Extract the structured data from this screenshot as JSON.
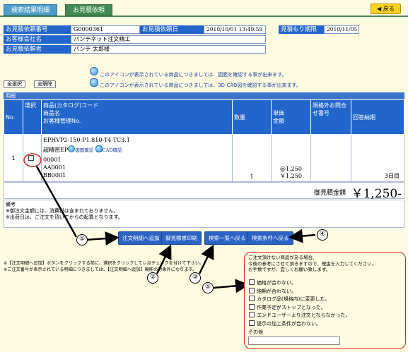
{
  "tabs": {
    "search_results": "検索結果明細",
    "quote_request": "お見積依頼"
  },
  "back_button": "◀ 戻る",
  "header_fields": {
    "quote_request_no_label": "お見積依頼番号",
    "quote_request_no": "G0000361",
    "request_date_label": "お見積依頼日",
    "request_date": "2010/10/01 13:49:59",
    "deadline_label": "見積もり期限",
    "deadline": "2010/11/05",
    "company_label": "お客様会社名",
    "company": "パンチネット注文精工",
    "requester_label": "お見積依頼者",
    "requester": "パンチ 太郎様"
  },
  "select_all_button": "全選択",
  "deselect_all_button": "全解除",
  "icon_notes": [
    "このアイコンが表示されている商品につきましては、図面を確認する事が出来ます。",
    "このアイコンが表示されている商品につきましては、3D-CAD図を確認する事が出来ます。"
  ],
  "section_title": "明細",
  "table": {
    "headers": {
      "no": "No.",
      "select": "選択",
      "product": "商品(カタログ)コード\n商品名\nお客様管理No.",
      "quantity": "数量",
      "unit_price": "単価\n金額",
      "non_standard": "規格外お問合せ番号",
      "delivery": "回答納期"
    },
    "rows": [
      {
        "no": "1",
        "catalog_code": "EPHVP2-150-P1.810-T4-TC3.1",
        "product_name": "超精密EP",
        "drawing_link": "図面確認",
        "cad_link": "CAD確認",
        "mgmt_no_1": "00001",
        "mgmt_no_2": "AA0001",
        "mgmt_no_3": "BB0001",
        "quantity": "1",
        "unit_price": "@1,250",
        "amount": "￥1,250",
        "non_standard_no": "",
        "delivery": "3日目"
      }
    ]
  },
  "total": {
    "label": "御見積金額",
    "value": "￥1,250-"
  },
  "remarks": {
    "title": "備考",
    "lines": [
      "※御注文金額には、消費税は含まれておりません。",
      "※出荷日は、ご注文を頂いてからの起算となります。"
    ]
  },
  "action_buttons": {
    "add_to_order": "注文明細へ追加",
    "print_quote": "御見積書印刷",
    "back_to_list": "検索一覧へ戻る",
    "back_to_conditions": "検索条件へ戻る"
  },
  "footnotes": [
    "※【注文明細へ追加】ボタンをクリックする前に、選択をクリックしてレ点チェックを付けて下さい。",
    "※ご注文番号が表示されている明細につきましては、【注文明細へ追加】機能の対象外になります。"
  ],
  "callouts": [
    "①",
    "②",
    "③",
    "④",
    "⑤"
  ],
  "reason_box": {
    "intro": [
      "ご注文頂けない商品がある場合、",
      "今後の参考にさせて頂きますので、理由を入力してください。",
      "お手数ですが、宜しくお願い致します。"
    ],
    "options": [
      "価格が合わない。",
      "納期が合わない。",
      "カタログ品(規格内)に変更した。",
      "作業予定がストップとなった。",
      "エンドユーザーより注文とならなかった。",
      "提示の加工条件が合わない。"
    ],
    "other_label": "その他",
    "other_value": ""
  },
  "colors": {
    "label_blue": "#2266cc",
    "tab_green": "#3f8a52",
    "back_yellow": "#ffd21f",
    "annotation_red": "#d42424",
    "page_bg": "#fffbe1"
  }
}
